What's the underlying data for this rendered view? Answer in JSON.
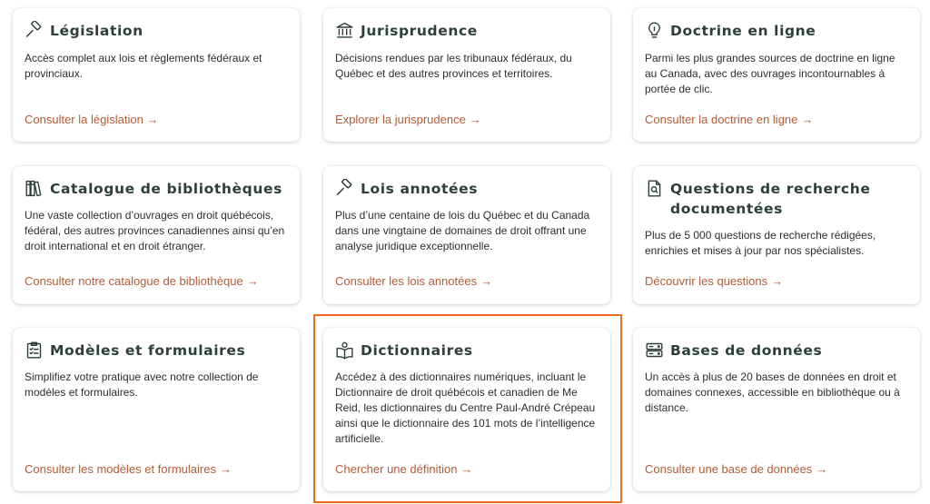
{
  "cards": [
    {
      "id": "legislation",
      "icon": "gavel-icon",
      "title": "Législation",
      "description": "Accès complet aux lois et règlements fédéraux et provinciaux.",
      "link": "Consulter la législation"
    },
    {
      "id": "jurisprudence",
      "icon": "courthouse-icon",
      "title": "Jurisprudence",
      "description": "Décisions rendues par les tribunaux fédéraux, du Québec et des autres provinces et territoires.",
      "link": "Explorer la jurisprudence"
    },
    {
      "id": "doctrine",
      "icon": "lightbulb-icon",
      "title": "Doctrine en ligne",
      "description": "Parmi les plus grandes sources de doctrine en ligne au Canada, avec des ouvrages incontournables à portée de clic.",
      "link": "Consulter la doctrine en ligne"
    },
    {
      "id": "catalogue",
      "icon": "books-icon",
      "title": "Catalogue de bibliothèques",
      "description": "Une vaste collection d’ouvrages en droit québécois, fédéral, des autres provinces canadiennes ainsi qu’en droit international et en droit étranger.",
      "link": "Consulter notre catalogue de bibliothèque"
    },
    {
      "id": "lois-annotees",
      "icon": "gavel-icon",
      "title": "Lois annotées",
      "description": "Plus d’une centaine de lois du Québec et du Canada dans une vingtaine de domaines de droit offrant une analyse juridique exceptionnelle.",
      "link": "Consulter les lois annotées"
    },
    {
      "id": "questions",
      "icon": "document-search-icon",
      "title": "Questions de recherche documentées",
      "description": "Plus de 5 000 questions de recherche rédigées, enrichies et mises à jour par nos spécialistes.",
      "link": "Découvrir les questions"
    },
    {
      "id": "modeles",
      "icon": "clipboard-icon",
      "title": "Modèles et formulaires",
      "description": "Simplifiez votre pratique avec notre collection de modèles et formulaires.",
      "link": "Consulter les modèles et formulaires"
    },
    {
      "id": "dictionnaires",
      "icon": "open-book-icon",
      "title": "Dictionnaires",
      "description": "Accédez à des dictionnaires numériques, incluant le Dictionnaire de droit québécois et canadien de Me Reid, les dictionnaires du Centre Paul-André Crépeau ainsi que le dictionnaire des 101 mots de l’intelligence artificielle.",
      "link": "Chercher une définition"
    },
    {
      "id": "bases",
      "icon": "server-icon",
      "title": "Bases de données",
      "description": "Un accès à plus de 20 bases de données en droit et domaines connexes, accessible en bibliothèque ou à distance.",
      "link": "Consulter une base de données"
    }
  ],
  "arrow": "→"
}
